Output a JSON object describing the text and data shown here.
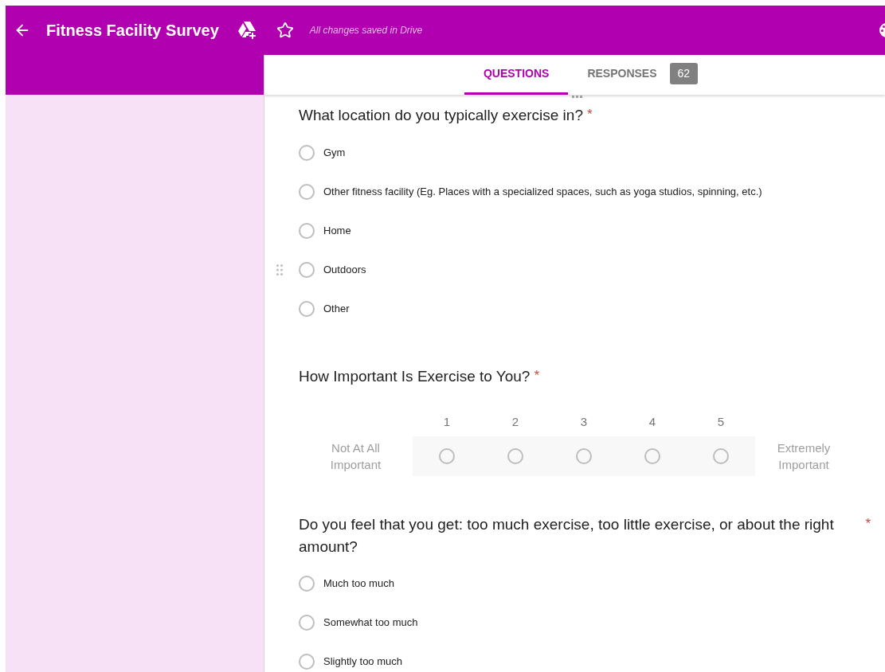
{
  "header": {
    "title": "Fitness Facility Survey",
    "save_status": "All changes saved in Drive"
  },
  "tabs": [
    {
      "label": "QUESTIONS",
      "selected": true
    },
    {
      "label": "RESPONSES",
      "selected": false,
      "count": "62"
    }
  ],
  "questions": [
    {
      "kind": "choice",
      "title": "What location do you typically exercise in?",
      "required_mark": "*",
      "options": [
        {
          "label": "Gym",
          "selected": false
        },
        {
          "label": "Other fitness facility (Eg. Places with a specialized spaces, such as yoga studios, spinning, etc.)",
          "selected": false
        },
        {
          "label": "Home",
          "selected": false
        },
        {
          "label": "Outdoors",
          "selected": false,
          "drag_handle": true
        },
        {
          "label": "Other",
          "selected": false
        }
      ]
    },
    {
      "kind": "scale",
      "title": "How Important Is Exercise to You?",
      "required_mark": "*",
      "low_label": "Not At All Important",
      "high_label": "Extremely Important",
      "points": [
        {
          "label": "1",
          "selected": false
        },
        {
          "label": "2",
          "selected": false
        },
        {
          "label": "3",
          "selected": false
        },
        {
          "label": "4",
          "selected": false
        },
        {
          "label": "5",
          "selected": false
        }
      ]
    },
    {
      "kind": "choice",
      "title": "Do you feel that you get: too much exercise, too little exercise, or about the right amount?",
      "required_mark": "*",
      "options": [
        {
          "label": "Much too much",
          "selected": false
        },
        {
          "label": "Somewhat too much",
          "selected": false
        },
        {
          "label": "Slightly too much",
          "selected": false
        }
      ]
    }
  ]
}
